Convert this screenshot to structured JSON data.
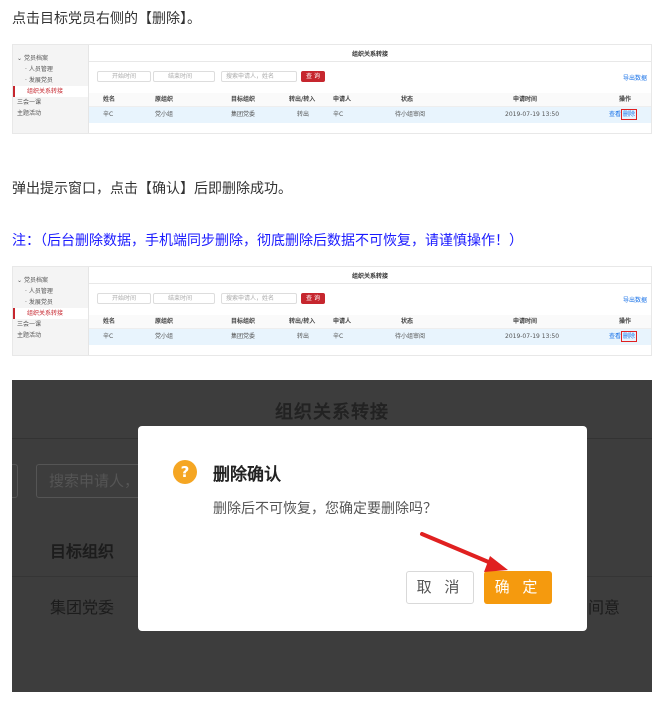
{
  "paragraphs": {
    "step1": "点击目标党员右侧的【删除】。",
    "step2": "弹出提示窗口，点击【确认】后即删除成功。",
    "note": "注：（后台删除数据，手机端同步删除，彻底删除后数据不可恢复，请谨慎操作！）"
  },
  "shot": {
    "sidebar": [
      "党员档案",
      "人员管理",
      "发展党员",
      "组织关系转接",
      "三会一课",
      "主题活动"
    ],
    "title": "组织关系转接",
    "inputs": {
      "start": "开始时间",
      "end": "结束时间",
      "search": "搜索申请人，姓名"
    },
    "query_button": "查 询",
    "export_link": "导出数据",
    "columns": [
      "姓名",
      "原组织",
      "目标组织",
      "转出/转入",
      "申请人",
      "状态",
      "申请时间",
      "操作"
    ],
    "row": [
      "辛C",
      "党小组",
      "集团党委",
      "转出",
      "辛C",
      "待小组审阅",
      "2019-07-19 13:50"
    ],
    "view_action": "查看",
    "delete_action": "删除"
  },
  "dialog": {
    "bg_title": "组织关系转接",
    "bg_search": "搜索申请人，",
    "bg_header": "目标组织",
    "bg_cell": "集团党委",
    "bg_cell_right": "间意",
    "icon": "question-icon",
    "title": "删除确认",
    "message": "删除后不可恢复，您确定要删除吗？",
    "cancel": "取 消",
    "confirm": "确 定"
  },
  "colors": {
    "accent": "#c6262e",
    "confirm": "#f59a0e",
    "note": "#1a1aff",
    "highlight": "#e02020"
  }
}
